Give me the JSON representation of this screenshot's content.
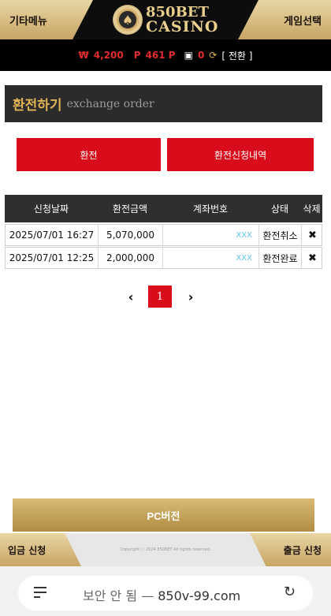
{
  "header": {
    "left_menu": "기타메뉴",
    "right_menu": "게임선택",
    "logo_line1": "850BET",
    "logo_line2": "CASINO"
  },
  "balance": {
    "money_symbol": "₩",
    "money": "4,200",
    "point_symbol": "P",
    "points": "461 P",
    "chips": "0",
    "convert_label": "[ 전환 ]"
  },
  "title": {
    "ko": "환전하기",
    "en": "exchange order"
  },
  "actions": {
    "exchange": "환전",
    "history": "환전신청내역"
  },
  "table": {
    "headers": [
      "신청날짜",
      "환전금액",
      "계좌번호",
      "상태",
      "삭제"
    ],
    "rows": [
      {
        "date": "2025/07/01 16:27",
        "amount": "5,070,000",
        "account": "XXX",
        "status": "환전취소",
        "delete": "✖"
      },
      {
        "date": "2025/07/01 12:25",
        "amount": "2,000,000",
        "account": "XXX",
        "status": "환전완료",
        "delete": "✖"
      }
    ]
  },
  "pagination": {
    "prev": "‹",
    "current": "1",
    "next": "›"
  },
  "pc_button": "PC버전",
  "footer": {
    "deposit": "입금 신청",
    "withdraw": "출금 신청",
    "copyright": "Copyright ⓒ 2024 850BET All rights reserved."
  },
  "browser": {
    "security": "보안 안 됨 —",
    "url": "850v-99.com"
  },
  "colors": {
    "accent_red": "#d90c1c",
    "gold": "#c8a564",
    "title_gold": "#e0b354"
  }
}
